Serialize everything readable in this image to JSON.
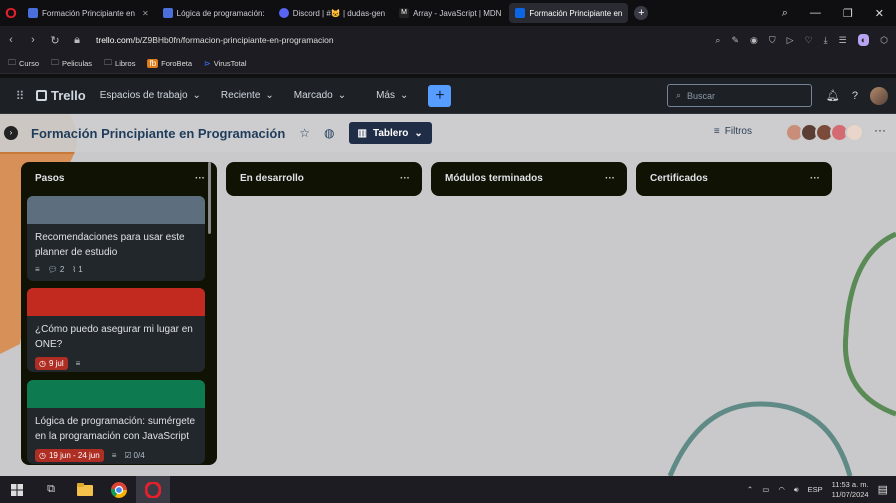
{
  "browser": {
    "tabs": [
      {
        "label": "Formación Principiante en",
        "fav": "#4a6fdc",
        "active": false
      },
      {
        "label": "Lógica de programación:",
        "fav": "#4a6fdc",
        "active": false
      },
      {
        "label": "Discord | #😺 | dudas-gen",
        "fav": "#5865f2",
        "active": false
      },
      {
        "label": "Array - JavaScript | MDN",
        "fav": "#222",
        "active": false
      },
      {
        "label": "Formación Principiante en",
        "fav": "#0c66e4",
        "active": true
      }
    ],
    "url_domain": "trello.com",
    "url_path": "/b/Z9BHb0fn/formacion-principiante-en-programacion",
    "bookmarks": [
      "Curso",
      "Peliculas",
      "Libros",
      "ForoBeta",
      "VirusTotal"
    ]
  },
  "trello": {
    "logo": "Trello",
    "menus": [
      "Espacios de trabajo",
      "Reciente",
      "Marcado",
      "Más"
    ],
    "search_placeholder": "Buscar"
  },
  "board": {
    "title": "Formación Principiante en Programación",
    "view_label": "Tablero",
    "filters_label": "Filtros",
    "lists": [
      {
        "title": "Pasos",
        "cards": [
          {
            "cover": "#5d6f7f",
            "title": "Recomendaciones para usar este planner de estudio",
            "comments": "2",
            "attachments": "1"
          },
          {
            "cover": "#c22a1f",
            "title": "¿Cómo puedo asegurar mi lugar en ONE?",
            "due": "9 jul"
          },
          {
            "cover": "#0d7a4f",
            "title": "Lógica de programación: sumérgete en la programación con JavaScript",
            "due": "19 jun - 24 jun",
            "checklist": "0/4"
          }
        ]
      },
      {
        "title": "En desarrollo"
      },
      {
        "title": "Módulos terminados"
      },
      {
        "title": "Certificados"
      }
    ]
  },
  "taskbar": {
    "lang": "ESP",
    "time": "11:53 a. m.",
    "date": "11/07/2024"
  }
}
